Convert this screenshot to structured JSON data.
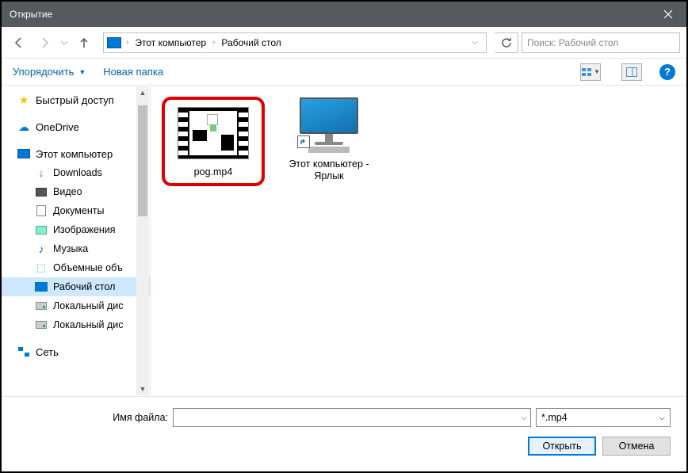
{
  "titlebar": {
    "title": "Открытие"
  },
  "nav": {
    "crumb1": "Этот компьютер",
    "crumb2": "Рабочий стол",
    "search_placeholder": "Поиск: Рабочий стол"
  },
  "toolbar": {
    "organize": "Упорядочить",
    "new_folder": "Новая папка"
  },
  "sidebar": {
    "quick_access": "Быстрый доступ",
    "onedrive": "OneDrive",
    "this_pc": "Этот компьютер",
    "downloads": "Downloads",
    "videos": "Видео",
    "documents": "Документы",
    "pictures": "Изображения",
    "music": "Музыка",
    "volumes": "Объемные объ",
    "desktop": "Рабочий стол",
    "local_disk1": "Локальный дис",
    "local_disk2": "Локальный дис",
    "network": "Сеть"
  },
  "files": {
    "item1": "pog.mp4",
    "item2": "Этот компьютер - Ярлык"
  },
  "footer": {
    "filename_label": "Имя файла:",
    "filename_value": "",
    "filter": "*.mp4",
    "open": "Открыть",
    "cancel": "Отмена"
  }
}
